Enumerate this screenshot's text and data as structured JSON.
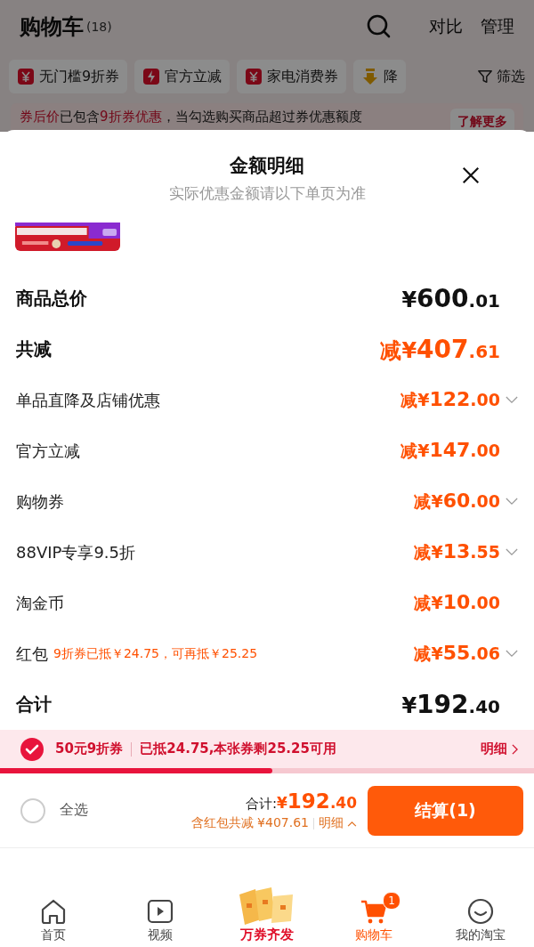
{
  "header": {
    "title": "购物车",
    "count": "(18)",
    "actions": [
      "对比",
      "管理"
    ]
  },
  "chips": [
    {
      "kind": "yen",
      "label": "无门槛9折券"
    },
    {
      "kind": "bolt",
      "label": "官方立减"
    },
    {
      "kind": "yen",
      "label": "家电消费券"
    },
    {
      "kind": "arrow",
      "label": "降"
    }
  ],
  "filter": {
    "label": "筛选"
  },
  "notice": {
    "text": "**券后价**已包含**9折券优惠**，当勾选购买商品超过券优惠额度",
    "button": "了解更多"
  },
  "sheet": {
    "title": "金额明细",
    "subtitle": "实际优惠金额请以下单页为准",
    "rows": [
      {
        "kind": "price",
        "label": "商品总价",
        "amount": "¥600.01",
        "expandable": false
      },
      {
        "kind": "saving",
        "label": "共减",
        "amount": "减¥407.61",
        "expandable": false
      },
      {
        "kind": "discount",
        "label": "单品直降及店铺优惠",
        "amount": "减¥122.00",
        "expandable": true
      },
      {
        "kind": "discount",
        "label": "官方立减",
        "amount": "减¥147.00",
        "expandable": false
      },
      {
        "kind": "discount",
        "label": "购物券",
        "amount": "减¥60.00",
        "expandable": true
      },
      {
        "kind": "discount",
        "label": "88VIP专享9.5折",
        "amount": "减¥13.55",
        "expandable": true
      },
      {
        "kind": "discount",
        "label": "淘金币",
        "amount": "减¥10.00",
        "expandable": false
      },
      {
        "kind": "discount",
        "label": "红包",
        "note": "9折券已抵￥24.75，可再抵￥25.25",
        "amount": "减¥55.06",
        "expandable": true
      },
      {
        "kind": "price",
        "label": "合计",
        "amount": "¥192.40",
        "expandable": false
      }
    ]
  },
  "coupon": {
    "checked": true,
    "name": "50元9折券",
    "status": "已抵24.75,本张券剩25.25可用",
    "link": "明细",
    "level": 0.51
  },
  "checkout": {
    "select_all": {
      "label": "全选",
      "checked": false
    },
    "total_label": "合计:",
    "total": "¥192.40",
    "saving": "含红包共减 ¥407.61",
    "detail": "明细",
    "button": "结算(1)"
  },
  "tabbar": [
    {
      "kind": "home",
      "label": "首页",
      "selected": false
    },
    {
      "kind": "video",
      "label": "视频",
      "selected": false
    },
    {
      "kind": "promo",
      "label": "万券齐发",
      "selected": false
    },
    {
      "kind": "cart",
      "label": "购物车",
      "selected": true,
      "badge": "1"
    },
    {
      "kind": "face",
      "label": "我的淘宝",
      "selected": false
    }
  ]
}
